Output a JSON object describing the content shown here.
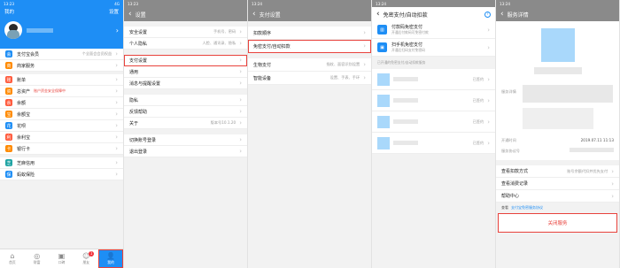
{
  "s1": {
    "status_time": "13:23",
    "status_right": "4G",
    "header_left": "我的",
    "header_right": "设置",
    "profile_name": "",
    "rows": [
      {
        "label": "支付宝会员",
        "value": "个全面会会员权益",
        "icon_color": "#1e8ef5",
        "icon": "会"
      },
      {
        "label": "商家服务",
        "value": "",
        "icon_color": "#ff8a00",
        "icon": "商"
      },
      {
        "label": "账单",
        "value": "",
        "icon_color": "#ff5a3c",
        "icon": "账"
      },
      {
        "label": "总资产",
        "value": "账户资金安全保障中",
        "icon_color": "#ff8a00",
        "icon": "资"
      },
      {
        "label": "余额",
        "value": "",
        "icon_color": "#ff5a3c",
        "icon": "余"
      },
      {
        "label": "余额宝",
        "value": "",
        "icon_color": "#ff8a00",
        "icon": "宝"
      },
      {
        "label": "花呗",
        "value": "",
        "icon_color": "#1e8ef5",
        "icon": "花"
      },
      {
        "label": "余利宝",
        "value": "",
        "icon_color": "#ff5a3c",
        "icon": "利"
      },
      {
        "label": "银行卡",
        "value": "",
        "icon_color": "#ff8a00",
        "icon": "卡"
      },
      {
        "label": "芝麻信用",
        "value": "",
        "icon_color": "#1fa3a3",
        "icon": "芝"
      },
      {
        "label": "蚂蚁保险",
        "value": "",
        "icon_color": "#1e8ef5",
        "icon": "保"
      }
    ],
    "tabbar": [
      {
        "label": "首页",
        "icon": "⌂"
      },
      {
        "label": "财富",
        "icon": "◎"
      },
      {
        "label": "口碑",
        "icon": "▣"
      },
      {
        "label": "朋友",
        "icon": "☺"
      },
      {
        "label": "我的",
        "icon": "👤"
      }
    ],
    "badge": "1"
  },
  "s2": {
    "status_time": "13:23",
    "title": "设置",
    "rows_a": [
      {
        "label": "安全设置",
        "value": "手机号、密码"
      },
      {
        "label": "个人隐私",
        "value": "人脸、通讯录、隐私"
      }
    ],
    "rows_b": [
      {
        "label": "支付设置",
        "value": ""
      },
      {
        "label": "通用",
        "value": ""
      },
      {
        "label": "消息与提醒设置",
        "value": ""
      }
    ],
    "rows_c": [
      {
        "label": "隐私",
        "value": ""
      },
      {
        "label": "反馈帮助",
        "value": ""
      },
      {
        "label": "关于",
        "value": "版本号10.1.20"
      }
    ],
    "rows_d": [
      {
        "label": "切换账号登录",
        "value": ""
      },
      {
        "label": "退出登录",
        "value": ""
      }
    ]
  },
  "s3": {
    "status_time": "13:24",
    "title": "支付设置",
    "rows_a": [
      {
        "label": "扣款顺序",
        "value": ""
      },
      {
        "label": "免密支付/自动扣款",
        "value": ""
      }
    ],
    "rows_b": [
      {
        "label": "生物支付",
        "value": "指纹、面容识别设置"
      },
      {
        "label": "智能设备",
        "value": "设置、手表、手环"
      }
    ]
  },
  "s4": {
    "status_time": "13:24",
    "title": "免密支付/自动扣款",
    "help": "?",
    "cards": [
      {
        "label": "付款码免密支付",
        "sub": "开通后付款码可免密付款"
      },
      {
        "label": "扫手机免密支付",
        "sub": "开通后扫码支付免密码"
      }
    ],
    "section_title": "已开通的免密支付/自动扣款服务",
    "items": [
      {
        "value": "已签约"
      },
      {
        "value": "已签约"
      },
      {
        "value": "已签约"
      },
      {
        "value": "已签约"
      }
    ]
  },
  "s5": {
    "status_time": "13:24",
    "title": "服务详情",
    "service_label": "服务详情",
    "date_label": "开通时间",
    "date_value": "2019.07.11 11:13",
    "id_label": "服务协议号",
    "rows": [
      {
        "label": "查看扣款方式",
        "value": "账号余额代扣并优先支付"
      },
      {
        "label": "查看消费记录",
        "value": ""
      },
      {
        "label": "帮助中心",
        "value": ""
      }
    ],
    "note_prefix": "查看",
    "note_link": "支付宝免密服务协议",
    "cancel_label": "关闭服务"
  }
}
